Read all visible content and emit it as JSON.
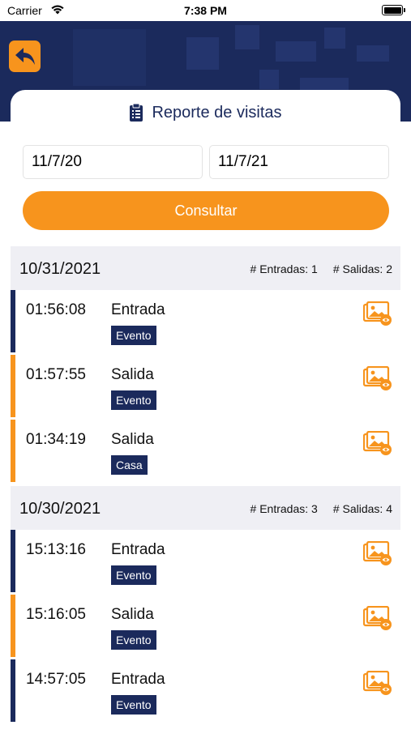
{
  "status_bar": {
    "carrier": "Carrier",
    "time": "7:38 PM"
  },
  "colors": {
    "primary": "#1b2a5c",
    "accent": "#f7941d",
    "entrada_bar": "#1b2a5c",
    "salida_bar": "#f7941d"
  },
  "header": {
    "back_icon": "back-arrow-icon"
  },
  "report": {
    "title": "Reporte de visitas",
    "title_icon": "clipboard-list-icon",
    "start_date": "11/7/20",
    "end_date": "11/7/21",
    "consult_label": "Consultar"
  },
  "groups": [
    {
      "date": "10/31/2021",
      "entradas": "# Entradas: 1",
      "salidas": "# Salidas: 2",
      "rows": [
        {
          "time": "01:56:08",
          "type": "Entrada",
          "badge": "Evento",
          "kind": "entrada"
        },
        {
          "time": "01:57:55",
          "type": "Salida",
          "badge": "Evento",
          "kind": "salida"
        },
        {
          "time": "01:34:19",
          "type": "Salida",
          "badge": "Casa",
          "kind": "salida"
        }
      ]
    },
    {
      "date": "10/30/2021",
      "entradas": "# Entradas: 3",
      "salidas": "# Salidas: 4",
      "rows": [
        {
          "time": "15:13:16",
          "type": "Entrada",
          "badge": "Evento",
          "kind": "entrada"
        },
        {
          "time": "15:16:05",
          "type": "Salida",
          "badge": "Evento",
          "kind": "salida"
        },
        {
          "time": "14:57:05",
          "type": "Entrada",
          "badge": "Evento",
          "kind": "entrada"
        }
      ]
    }
  ]
}
